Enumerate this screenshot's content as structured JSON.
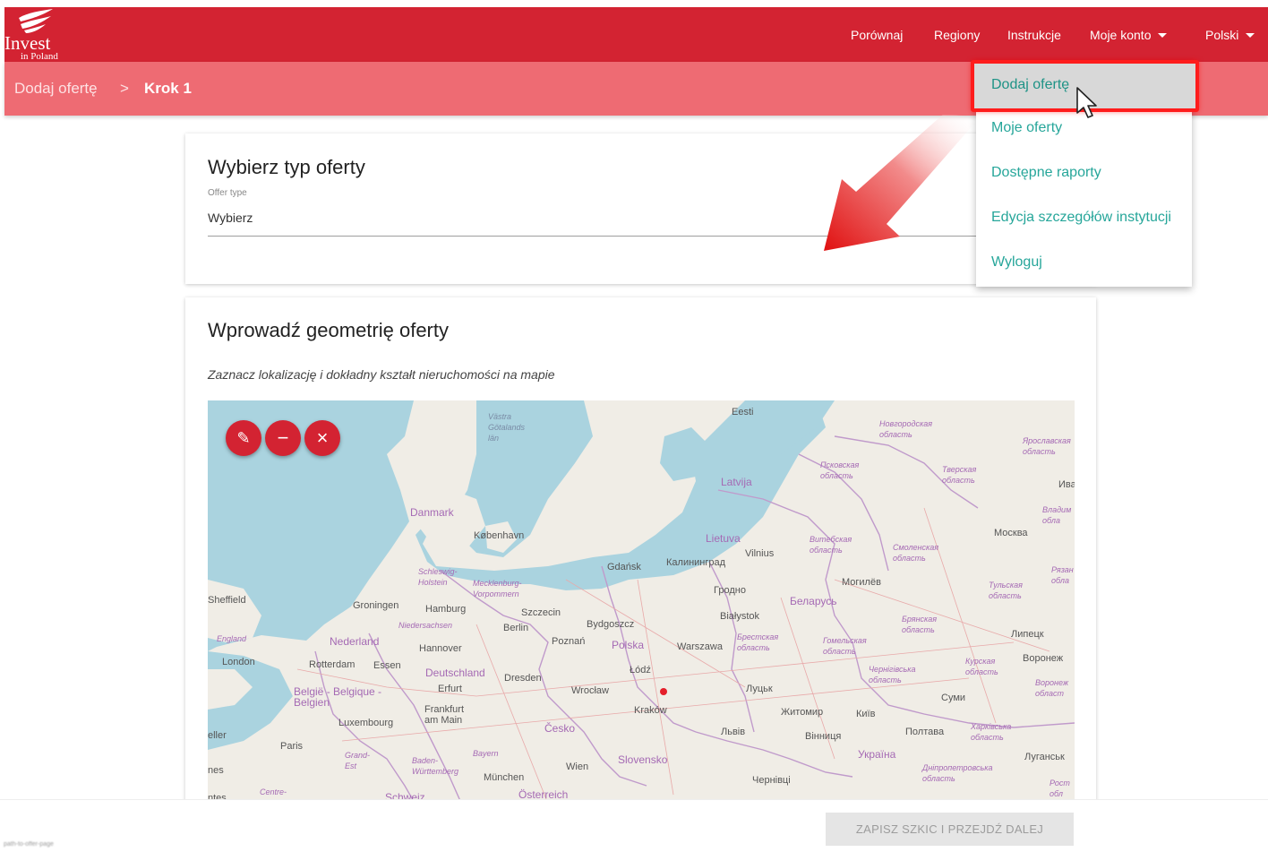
{
  "nav": {
    "logo_title": "Invest",
    "logo_sub": "in Poland",
    "compare": "Porównaj",
    "regions": "Regiony",
    "instructions": "Instrukcje",
    "account": "Moje konto",
    "language": "Polski"
  },
  "breadcrumb": {
    "parent": "Dodaj ofertę",
    "separator": ">",
    "current": "Krok 1"
  },
  "offer_type": {
    "title": "Wybierz typ oferty",
    "label": "Offer type",
    "value": "Wybierz"
  },
  "geometry": {
    "title": "Wprowadź geometrię oferty",
    "hint": "Zaznacz lokalizację i dokładny kształt nieruchomości na mapie"
  },
  "map": {
    "labels": {
      "eesti": "Eesti",
      "latvija": "Latvija",
      "lietuva": "Lietuva",
      "danmark": "Danmark",
      "kobenhavn": "København",
      "gdansk": "Gdańsk",
      "kaliningrad": "Калининград",
      "vilnius": "Vilnius",
      "hrodna": "Гродно",
      "bialystok": "Białystok",
      "bydgoszcz": "Bydgoszcz",
      "szczecin": "Szczecin",
      "berlin": "Berlin",
      "hamburg": "Hamburg",
      "groningen": "Groningen",
      "nederland": "Nederland",
      "hannover": "Hannover",
      "poznan": "Poznań",
      "polska": "Polska",
      "warszawa": "Warszawa",
      "lodz": "Łódź",
      "wroclaw": "Wrocław",
      "krakow": "Kraków",
      "deutschland": "Deutschland",
      "dresden": "Dresden",
      "erfurt": "Erfurt",
      "frankfurt": "Frankfurt am Main",
      "rotterdam": "Rotterdam",
      "essen": "Essen",
      "london": "London",
      "belgique": "België - Belgique - Belgien",
      "luxembourg": "Luxembourg",
      "paris": "Paris",
      "cesko": "Česko",
      "slovensko": "Slovensko",
      "wien": "Wien",
      "munchen": "München",
      "osterreich": "Österreich",
      "schweiz": "Schweiz",
      "bayern": "Bayern",
      "moskva": "Москва",
      "mogilev": "Могилёв",
      "belarus": "Беларусь",
      "lutsk": "Луцьк",
      "lviv": "Львів",
      "zhytomyr": "Житомир",
      "kyiv": "Київ",
      "vinnytsia": "Вінниця",
      "ukraina": "Україна",
      "poltava": "Полтава",
      "sumy": "Суми",
      "voronezh": "Воронеж",
      "lipetsk": "Липецк",
      "luhansk": "Луганськ",
      "chernivtsi": "Чернівці",
      "novgorod": "Новгородская область",
      "pskov": "Псковская область",
      "tver": "Тверская область",
      "yaroslavl": "Ярославская область",
      "vitebsk": "Витебская область",
      "smolensk": "Смоленская область",
      "bryansk": "Брянская область",
      "gomel": "Гомельская область",
      "brest": "Брестская область",
      "tula": "Тульская область",
      "kursk": "Курская область",
      "chernihiv": "Чернігівська область",
      "kharkiv": "Харківська область",
      "dnipro": "Дніпропетровська область",
      "niedersachsen": "Niedersachsen",
      "schleswig": "Schleswig-Holstein",
      "mecklenburg": "Mecklenburg-Vorpommern",
      "baden": "Baden-Württemberg",
      "england": "England",
      "vastra": "Västra Götalands län",
      "grandest": "Grand-Est",
      "centre": "Centre-",
      "sheffield": "Sheffield",
      "eller": "eller",
      "nes": "nes",
      "ntes": "ntes",
      "iva": "Ива",
      "vladim": "Владим обла",
      "ryazan": "Рязан обла",
      "voronezh_obl": "Воронеж област",
      "rost": "Рост обл"
    }
  },
  "map_controls": {
    "edit_glyph": "✎",
    "remove_glyph": "−",
    "clear_glyph": "×"
  },
  "footer": {
    "save_label": "ZAPISZ SZKIC I PRZEJDŹ DALEJ",
    "url": "path-to-offer-page"
  },
  "dropdown": {
    "items": [
      "Dodaj ofertę",
      "Moje oferty",
      "Dostępne raporty",
      "Edycja szczegółów instytucji",
      "Wyloguj"
    ]
  },
  "colors": {
    "brand_red": "#d32332",
    "breadcrumb_bg": "#ee6b73",
    "link_teal": "#26a69a",
    "highlight_red": "#ff1c1c"
  }
}
